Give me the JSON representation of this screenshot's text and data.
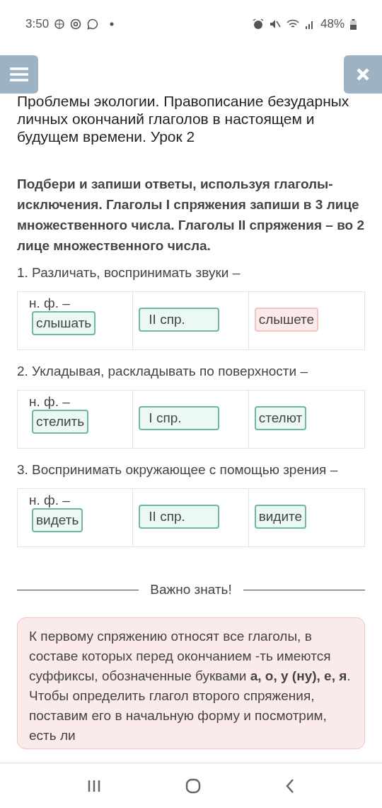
{
  "status_bar": {
    "time": "3:50",
    "battery": "48%"
  },
  "title": "Проблемы экологии. Правописание безударных личных окончаний глаголов в настоящем и будущем времени. Урок 2",
  "instruction": "Подбери и запиши ответы, используя глаголы-исключения. Глаголы I спряжения запиши в 3 лице множественного числа. Глаголы II спряжения – во 2 лице множественного числа.",
  "tasks": [
    {
      "prompt": "1. Различать, воспринимать звуки –",
      "form_label": "н. ф. –",
      "answers": [
        {
          "text": "слышать",
          "correct": true
        },
        {
          "text": "II спр.",
          "correct": true
        },
        {
          "text": "слышете",
          "correct": false
        }
      ]
    },
    {
      "prompt": "2. Укладывая, раскладывать по поверхности –",
      "form_label": "н. ф. –",
      "answers": [
        {
          "text": "стелить",
          "correct": true
        },
        {
          "text": "I спр.",
          "correct": true
        },
        {
          "text": "стелют",
          "correct": true
        }
      ]
    },
    {
      "prompt": "3. Воспринимать окружающее с помощью зрения –",
      "form_label": "н. ф. –",
      "answers": [
        {
          "text": "видеть",
          "correct": true
        },
        {
          "text": "II спр.",
          "correct": true
        },
        {
          "text": "видите",
          "correct": true
        }
      ]
    }
  ],
  "section_heading": "Важно знать!",
  "note": "К первому спряжению относят все глаголы, в составе которых перед окончанием -ть имеются суффиксы, обозначенные буквами **а, о, у (ну), е, я**. Чтобы определить глагол второго спряжения, поставим его в начальную форму и посмотрим, есть ли"
}
